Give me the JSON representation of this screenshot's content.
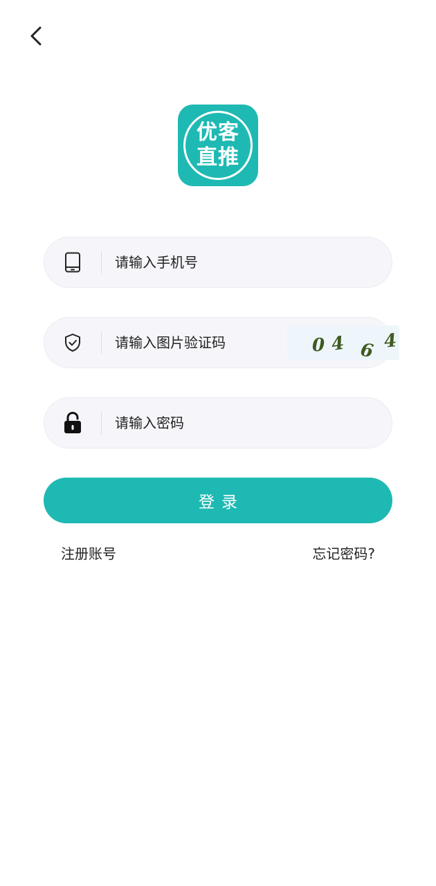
{
  "header": {
    "back_icon": "chevron-left-icon"
  },
  "logo": {
    "line1": "优客",
    "line2": "直推",
    "color": "#1fb9b3"
  },
  "form": {
    "phone": {
      "placeholder": "请输入手机号",
      "icon": "phone-icon"
    },
    "captcha": {
      "placeholder": "请输入图片验证码",
      "icon": "shield-check-icon",
      "image_chars": [
        "0",
        "4",
        "6",
        "4"
      ]
    },
    "password": {
      "placeholder": "请输入密码",
      "icon": "lock-icon"
    }
  },
  "login_button": {
    "label": "登录",
    "color": "#1fb9b3"
  },
  "links": {
    "register": "注册账号",
    "forgot": "忘记密码?"
  }
}
